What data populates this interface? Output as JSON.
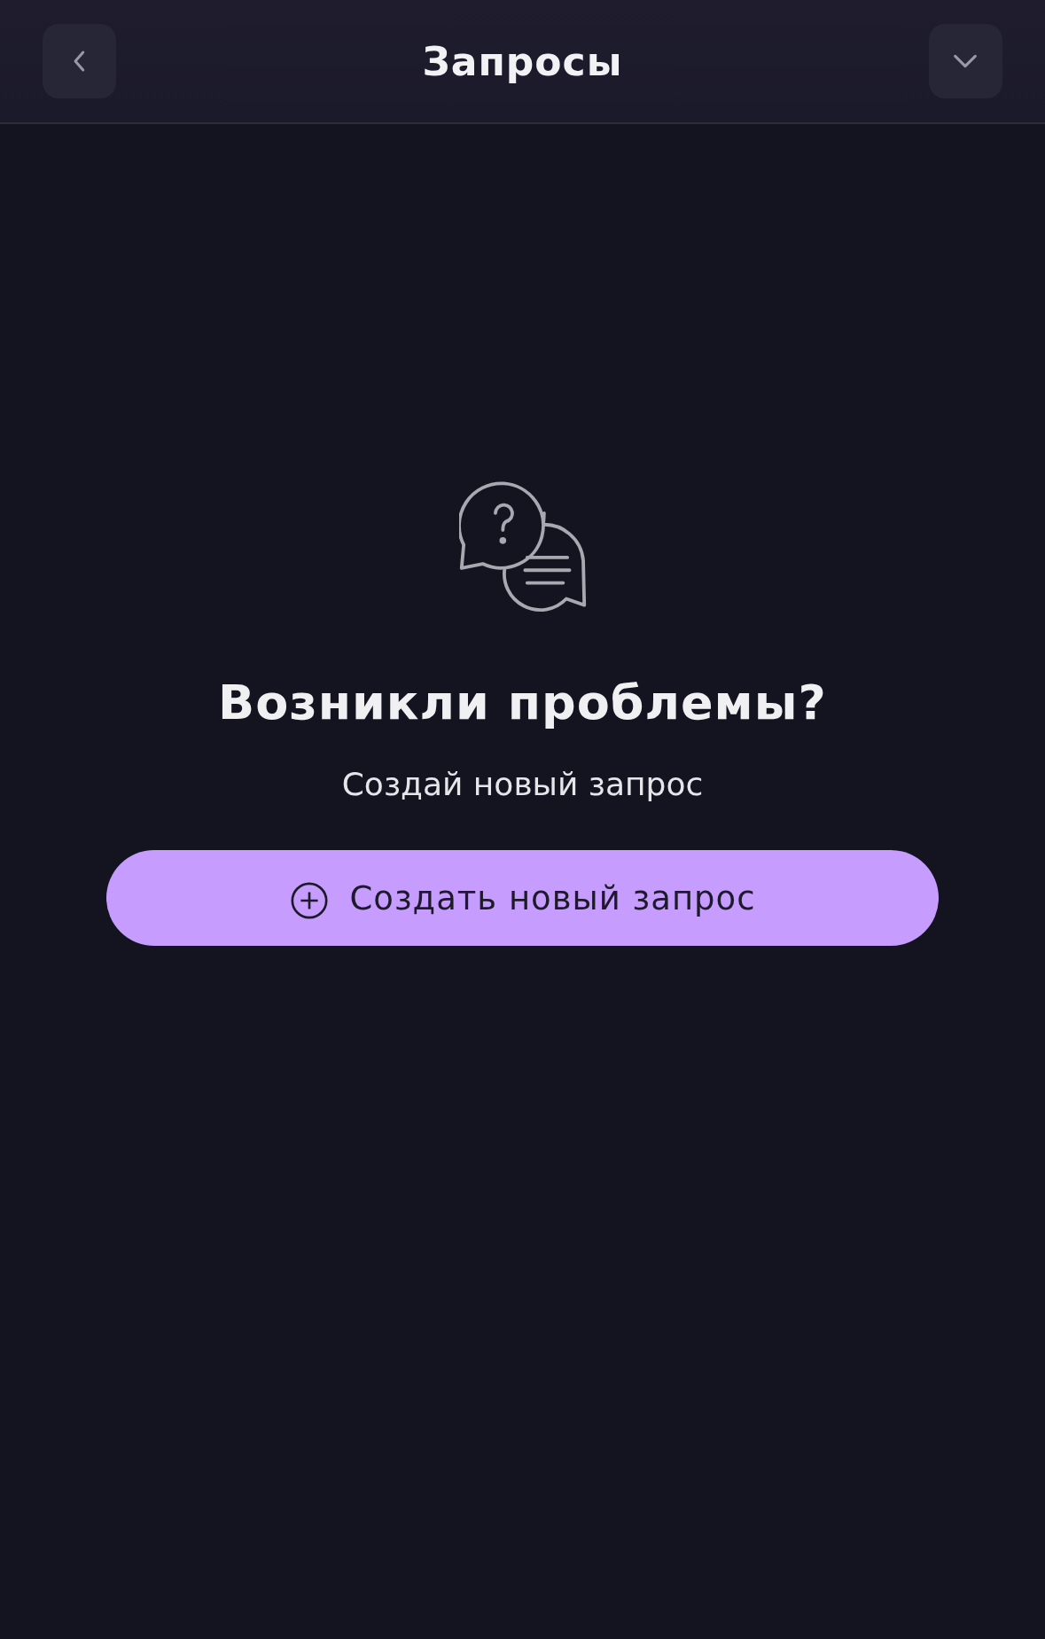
{
  "header": {
    "title": "Запросы"
  },
  "empty_state": {
    "heading": "Возникли проблемы?",
    "subtitle": "Создай новый запрос"
  },
  "create_button": {
    "label": "Создать новый запрос"
  }
}
